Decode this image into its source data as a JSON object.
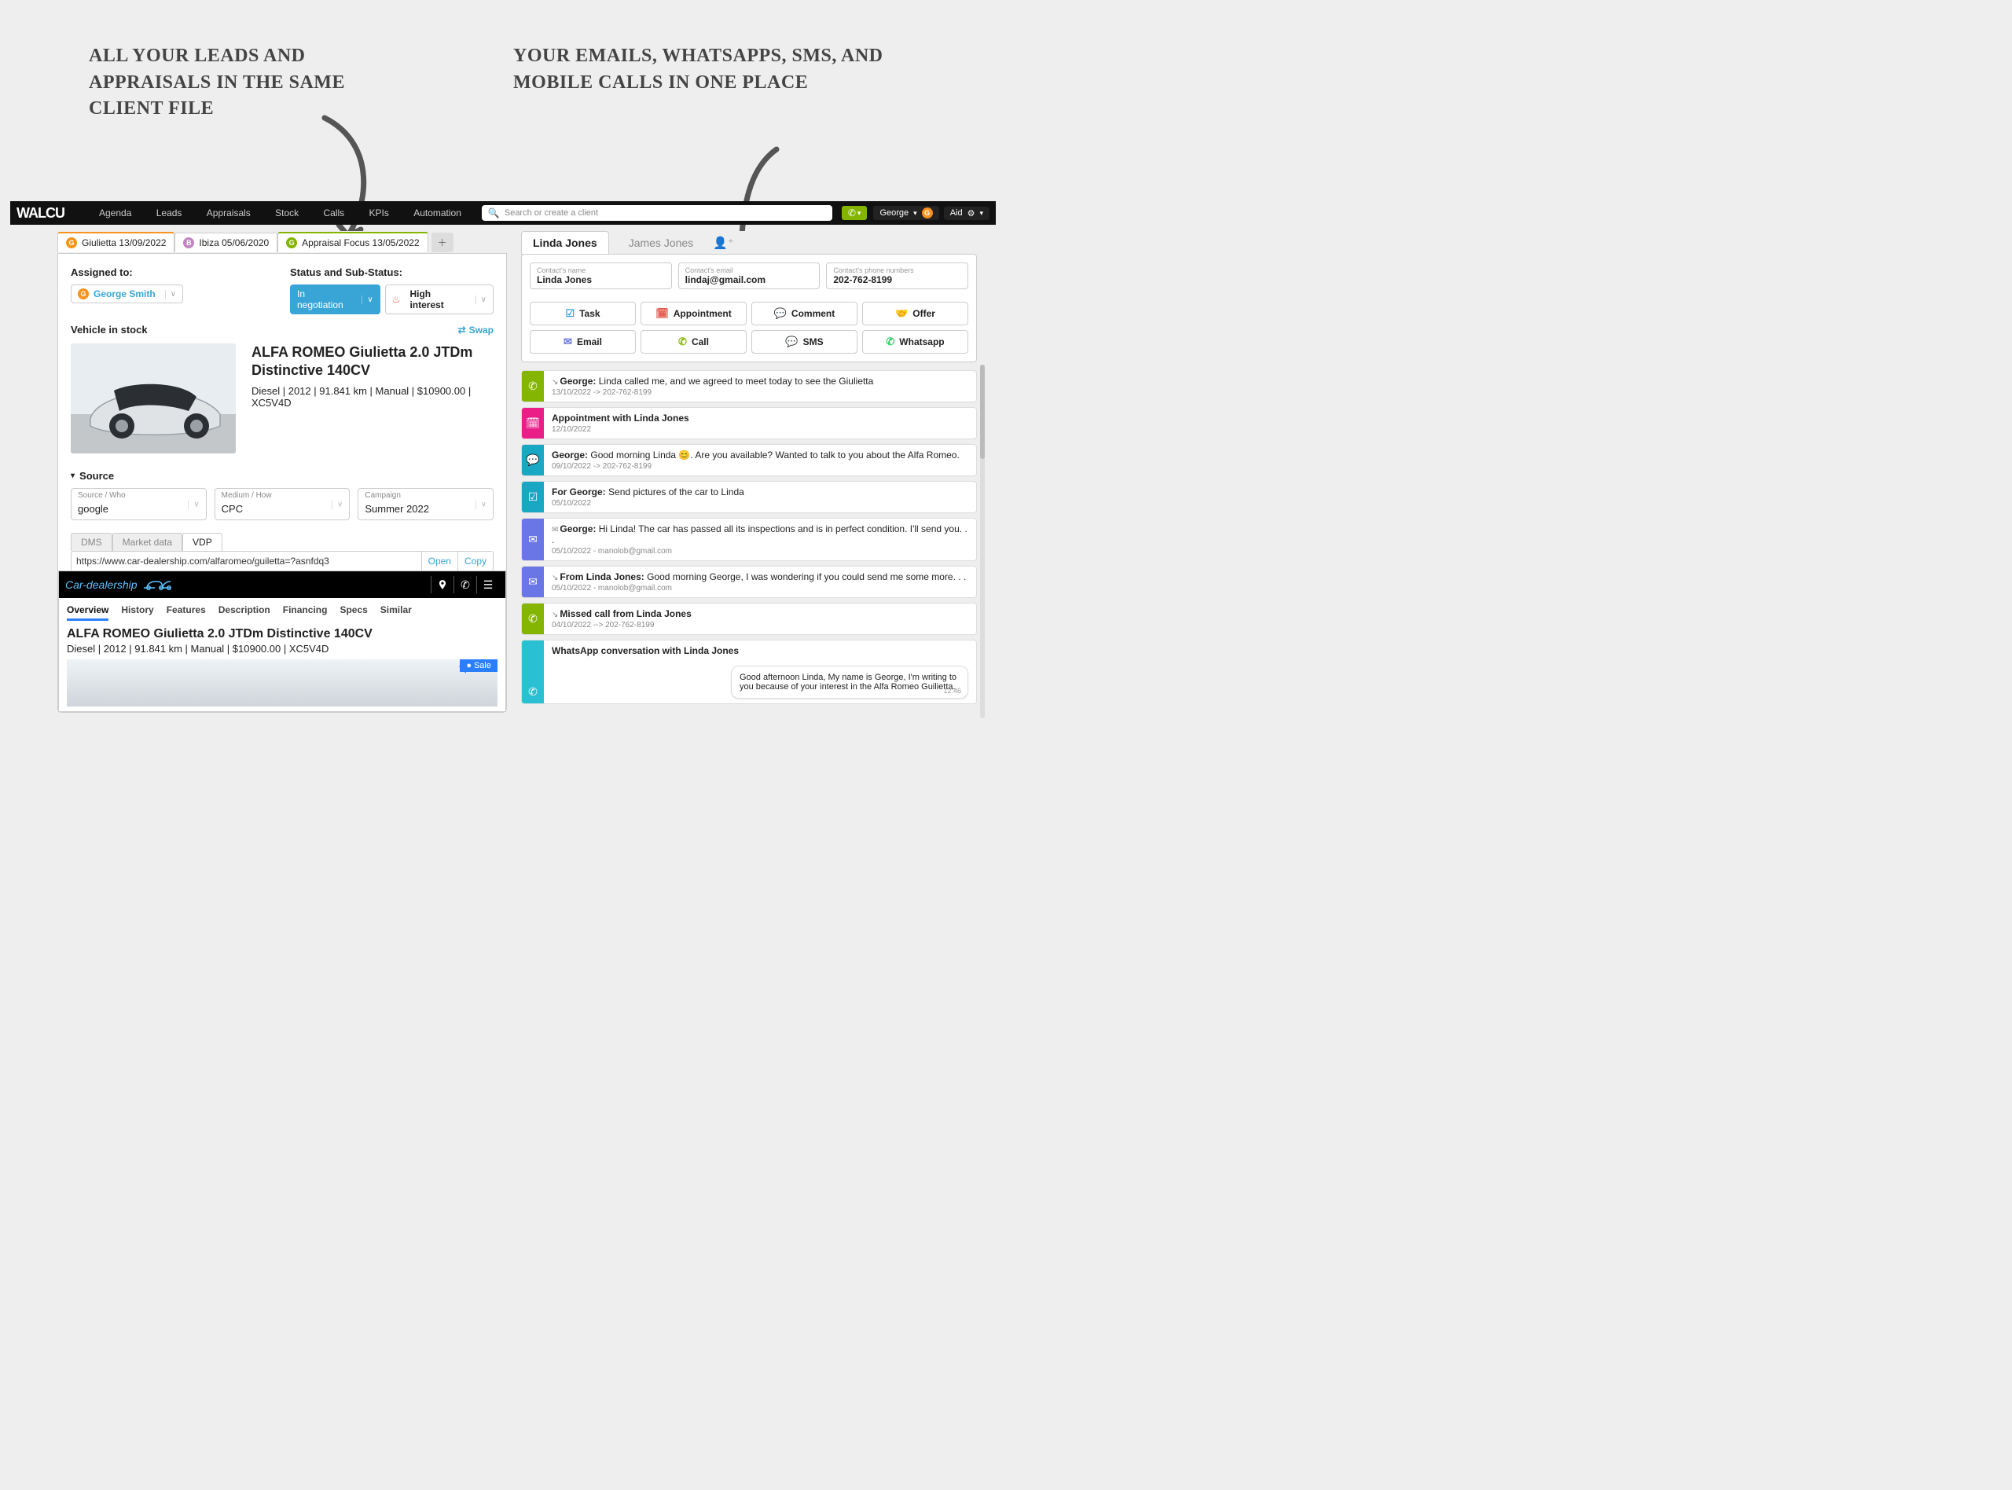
{
  "annotations": {
    "left": "All your leads and appraisals in the same client file",
    "right": "Your emails, WhatsApps, SMS, and mobile calls in one place"
  },
  "topbar": {
    "logo": "WALCU",
    "nav": [
      "Agenda",
      "Leads",
      "Appraisals",
      "Stock",
      "Calls",
      "KPIs",
      "Automation"
    ],
    "search_placeholder": "Search or create a client",
    "call_icon": "📞",
    "user_name": "George",
    "aid_label": "Aid"
  },
  "left": {
    "tabs": [
      {
        "badge": "G",
        "label": "Giulietta 13/09/2022"
      },
      {
        "badge": "B",
        "label": "Ibiza 05/06/2020"
      },
      {
        "badge": "G",
        "label": "Appraisal Focus 13/05/2022"
      }
    ],
    "assigned_label": "Assigned to:",
    "assigned_value": "George Smith",
    "status_label": "Status and Sub-Status:",
    "status_value": "In negotiation",
    "substatus_value": "High interest",
    "vehicle_label": "Vehicle in stock",
    "swap_label": "Swap",
    "vehicle_title": "ALFA ROMEO Giulietta 2.0 JTDm Distinctive 140CV",
    "vehicle_meta": "Diesel | 2012 | 91.841 km | Manual | $10900.00 | XC5V4D",
    "source_label": "Source",
    "source_who_label": "Source / Who",
    "source_who": "google",
    "medium_label": "Medium / How",
    "medium": "CPC",
    "campaign_label": "Campaign",
    "campaign": "Summer 2022",
    "vdp_tabs": [
      "DMS",
      "Market data",
      "VDP"
    ],
    "vdp_url": "https://www.car-dealership.com/alfaromeo/guiletta=?asnfdq3",
    "open_label": "Open",
    "copy_label": "Copy",
    "vdp_brand": "Car-dealership",
    "vdp_nav": [
      "Overview",
      "History",
      "Features",
      "Description",
      "Financing",
      "Specs",
      "Similar"
    ],
    "vdp_title": "ALFA ROMEO Giulietta 2.0 JTDm Distinctive 140CV",
    "vdp_meta": "Diesel | 2012 | 91.841 km | Manual | $10900.00 | XC5V4D",
    "sale_label": "Sale"
  },
  "right": {
    "tab1": "Linda Jones",
    "tab2": "James Jones",
    "contact_name_label": "Contact's name",
    "contact_name": "Linda Jones",
    "contact_email_label": "Contact's email",
    "contact_email": "lindaj@gmail.com",
    "contact_phone_label": "Contact's phone numbers",
    "contact_phone": "202-762-8199",
    "actions": {
      "task": "Task",
      "appointment": "Appointment",
      "comment": "Comment",
      "offer": "Offer",
      "email": "Email",
      "call": "Call",
      "sms": "SMS",
      "whatsapp": "Whatsapp"
    },
    "t1_who": "George:",
    "t1_text": "Linda called me, and we agreed to meet today to see the Giulietta",
    "t1_date": "13/10/2022 -> 202-762-8199",
    "t2_text": "Appointment with Linda Jones",
    "t2_date": "12/10/2022",
    "t3_who": "George:",
    "t3_text": "Good morning Linda 😊. Are you available? Wanted to talk to you about the Alfa Romeo.",
    "t3_date": "09/10/2022 -> 202-762-8199",
    "t4_who": "For George:",
    "t4_text": "Send pictures of the car to Linda",
    "t4_date": "05/10/2022",
    "t5_who": "George:",
    "t5_text": "Hi Linda! The car has passed all its inspections and is in perfect condition.  I'll send you. . .",
    "t5_date": "05/10/2022 - manolob@gmail.com",
    "t6_who": "From Linda Jones:",
    "t6_text": "Good morning George, I was wondering if you could send me some more. . .",
    "t6_date": "05/10/2022 - manolob@gmail.com",
    "t7_text": "Missed call from Linda Jones",
    "t7_date": "04/10/2022 --> 202-762-8199",
    "wa_title": "WhatsApp conversation with Linda Jones",
    "wa_bubble": "Good afternoon Linda, My name is George, I'm writing to you because of your interest in the Alfa Romeo Guilietta.",
    "wa_time": "12:46"
  }
}
